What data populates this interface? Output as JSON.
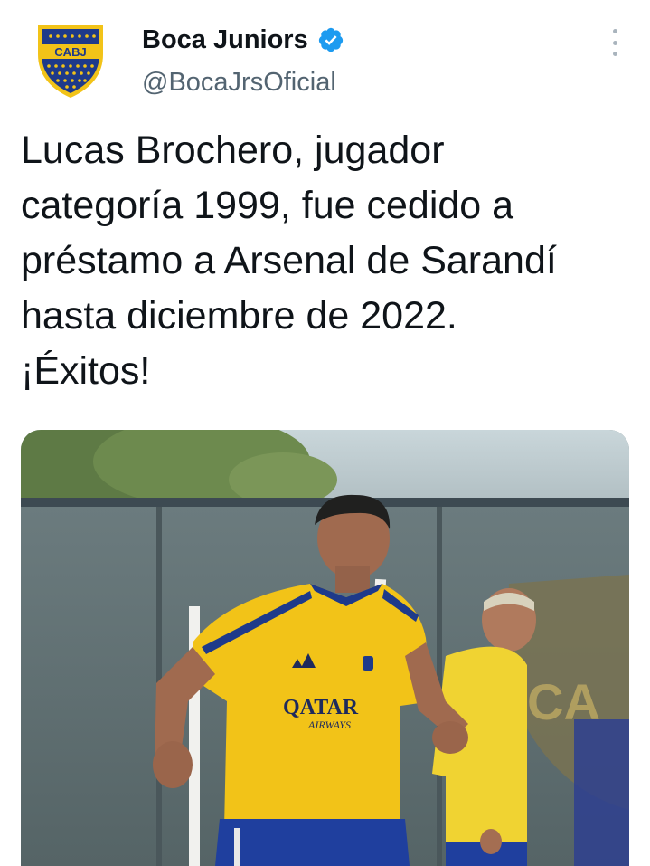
{
  "author": {
    "display_name": "Boca Juniors",
    "handle": "@BocaJrsOficial",
    "verified": true,
    "avatar_text": "CABJ"
  },
  "tweet": {
    "lines": [
      "Lucas Brochero, jugador",
      "categoría 1999, fue cedido a",
      "préstamo a Arsenal de Sarandí",
      "hasta diciembre de 2022.",
      "¡Éxitos!"
    ]
  },
  "media": {
    "shirt_sponsor": "QATAR",
    "shirt_sponsor_sub": "AIRWAYS",
    "wall_crest_text": "CA"
  },
  "colors": {
    "text_primary": "#0f1419",
    "text_secondary": "#536471",
    "verified_blue": "#1d9bf0",
    "boca_blue": "#1e3a8a",
    "boca_gold": "#f2c318"
  },
  "icons": {
    "verified": "verified-badge-icon",
    "more": "more-options-icon"
  }
}
